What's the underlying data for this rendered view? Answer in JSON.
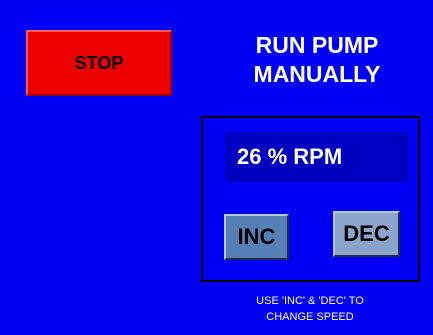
{
  "stop_button": {
    "label": "STOP"
  },
  "title": {
    "line1": "RUN PUMP",
    "line2": "MANUALLY"
  },
  "speed": {
    "display": "26 % RPM",
    "value_percent": 26
  },
  "controls": {
    "inc_label": "INC",
    "dec_label": "DEC"
  },
  "instructions": {
    "line1": "USE 'INC' & 'DEC' TO",
    "line2": "CHANGE SPEED"
  },
  "colors": {
    "background": "#0000f3",
    "stop_button": "#ec0000",
    "speed_display": "#0000c0",
    "inc_button": "#5580b6",
    "dec_button": "#8aa5cc",
    "text_light": "#ffffff"
  }
}
